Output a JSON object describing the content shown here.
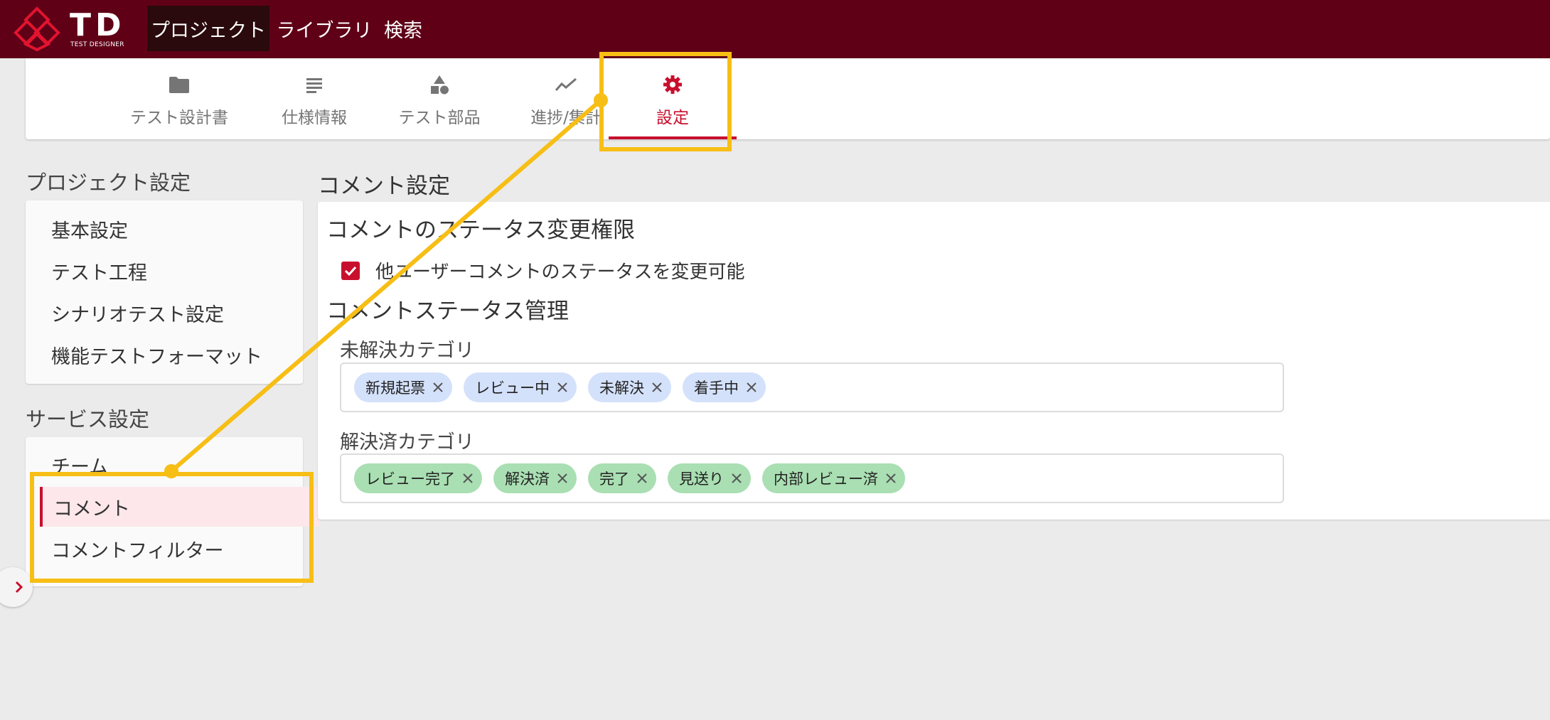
{
  "header": {
    "logo_text": "TD",
    "logo_sub": "TEST DESIGNER",
    "nav": [
      {
        "label": "プロジェクト",
        "active": true
      },
      {
        "label": "ライブラリ",
        "active": false
      },
      {
        "label": "検索",
        "active": false
      }
    ]
  },
  "tabs": [
    {
      "label": "テスト設計書",
      "icon": "folder-icon"
    },
    {
      "label": "仕様情報",
      "icon": "list-icon"
    },
    {
      "label": "テスト部品",
      "icon": "shapes-icon"
    },
    {
      "label": "進捗/集計",
      "icon": "trend-icon"
    },
    {
      "label": "設定",
      "icon": "gear-icon",
      "active": true
    }
  ],
  "sidebar": {
    "project_title": "プロジェクト設定",
    "project_items": [
      "基本設定",
      "テスト工程",
      "シナリオテスト設定",
      "機能テストフォーマット"
    ],
    "service_title": "サービス設定",
    "service_items": [
      "チーム",
      "コメント",
      "コメントフィルター"
    ],
    "active_item": "コメント"
  },
  "main": {
    "title": "コメント設定",
    "permission_title": "コメントのステータス変更権限",
    "permission_checkbox": {
      "label": "他ユーザーコメントのステータスを変更可能",
      "checked": true
    },
    "status_title": "コメントステータス管理",
    "unresolved_label": "未解決カテゴリ",
    "unresolved_chips": [
      "新規起票",
      "レビュー中",
      "未解決",
      "着手中"
    ],
    "resolved_label": "解決済カテゴリ",
    "resolved_chips": [
      "レビュー完了",
      "解決済",
      "完了",
      "見送り",
      "内部レビュー済"
    ]
  },
  "colors": {
    "header_bg": "#5f0017",
    "accent": "#c8102e",
    "unresolved_chip": "#d4e1fb",
    "resolved_chip": "#a9dfb2",
    "annotation": "#f7be15"
  }
}
